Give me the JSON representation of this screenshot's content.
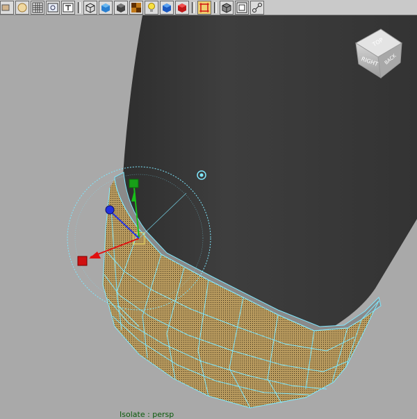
{
  "toolbar": {
    "buttons": [
      {
        "name": "camera-attributes-icon"
      },
      {
        "name": "select-camera-icon"
      },
      {
        "name": "grid-icon"
      },
      {
        "name": "film-gate-icon"
      },
      {
        "name": "resolution-gate-icon"
      },
      {
        "name": "wireframe-icon"
      },
      {
        "name": "smooth-shade-all-icon"
      },
      {
        "name": "flat-shade-icon"
      },
      {
        "name": "textured-icon"
      },
      {
        "name": "use-all-lights-icon"
      },
      {
        "name": "shadows-icon"
      },
      {
        "name": "xray-icon"
      },
      {
        "name": "isolate-select-icon"
      },
      {
        "name": "xray-joints-icon"
      },
      {
        "name": "safe-frame-icon"
      },
      {
        "name": "joint-icon"
      }
    ]
  },
  "viewcube": {
    "right_label": "RIGHT",
    "back_label": "BACK",
    "top_label": "TOP"
  },
  "viewport": {
    "label": "Isolate : persp"
  },
  "colors": {
    "background": "#a9a9a9",
    "mesh_dark": "#3c3c3c",
    "mesh_selected": "#b89a5e",
    "wire_highlight": "#7fe8ff",
    "manipulator_x": "#e01010",
    "manipulator_y": "#18c018",
    "manipulator_z": "#2030e0"
  }
}
